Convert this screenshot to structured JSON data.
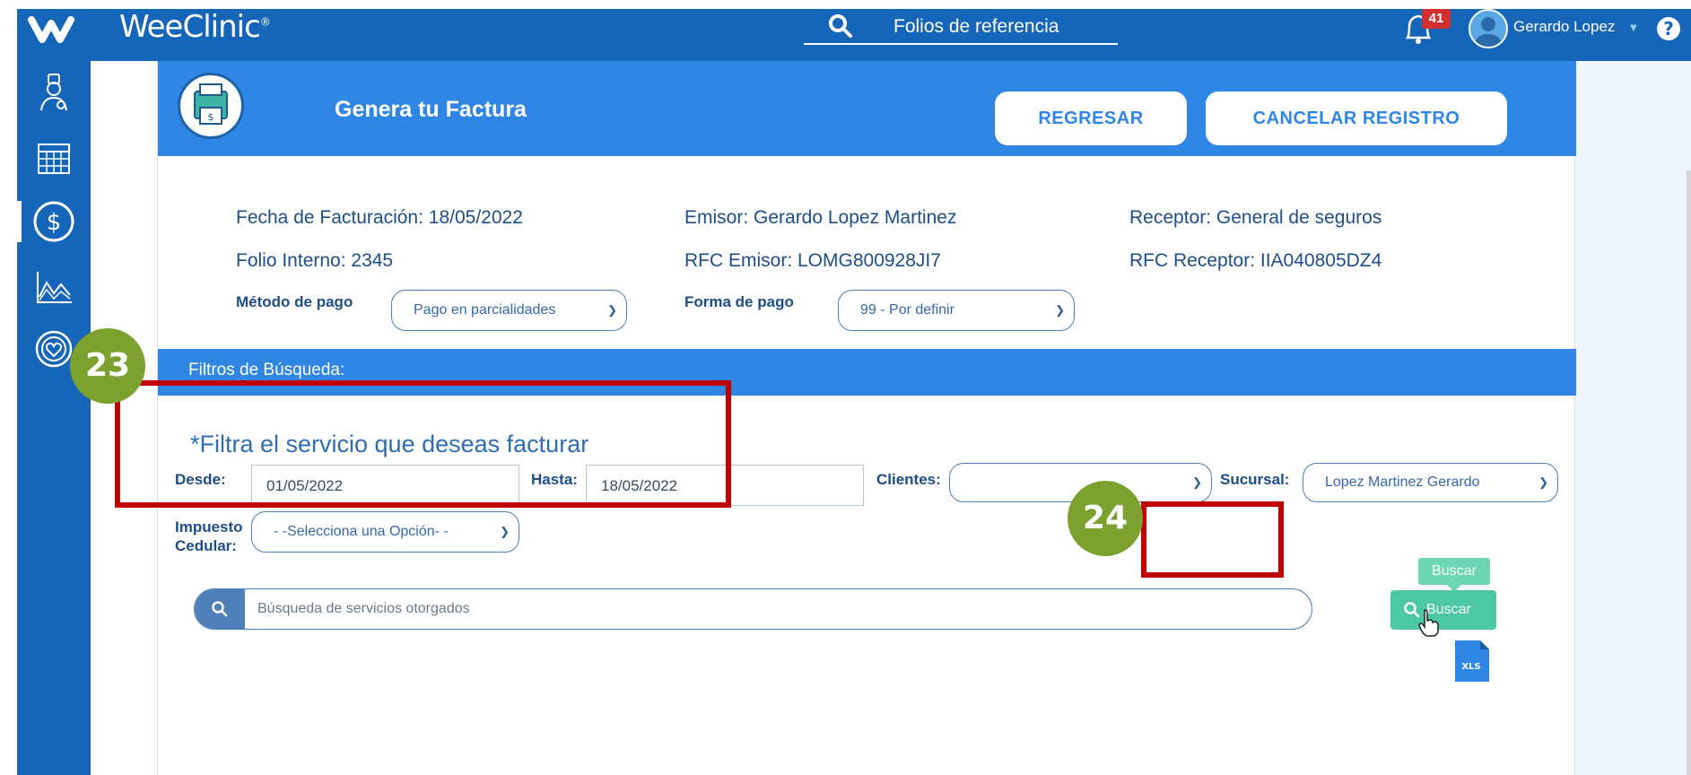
{
  "header": {
    "brand": "WeeClinic",
    "brand_mark": "®",
    "search_label": "Folios de referencia",
    "notification_count": "41",
    "user_name": "Gerardo Lopez"
  },
  "sidebar": {
    "items": [
      {
        "name": "doctor-icon"
      },
      {
        "name": "calendar-icon"
      },
      {
        "name": "billing-dollar-icon",
        "active": true
      },
      {
        "name": "chart-icon"
      },
      {
        "name": "heart-target-icon"
      }
    ]
  },
  "card": {
    "title": "Genera tu Factura",
    "back_button": "REGRESAR",
    "cancel_button": "CANCELAR REGISTRO"
  },
  "invoice": {
    "fecha": "Fecha de Facturación: 18/05/2022",
    "emisor": "Emisor: Gerardo Lopez Martinez",
    "receptor": "Receptor: General de seguros",
    "folio": "Folio Interno: 2345",
    "rfc_emisor": "RFC Emisor: LOMG800928JI7",
    "rfc_receptor": "RFC Receptor: IIA040805DZ4",
    "metodo_label": "Método de pago",
    "metodo_value": "Pago en parcialidades",
    "forma_label": "Forma de pago",
    "forma_value": "99 - Por definir"
  },
  "filters": {
    "bar_title": "Filtros de Búsqueda:",
    "subtitle": "*Filtra el servicio que deseas facturar",
    "desde_label": "Desde:",
    "desde_value": "01/05/2022",
    "hasta_label": "Hasta:",
    "hasta_value": "18/05/2022",
    "clientes_label": "Clientes:",
    "clientes_value": "",
    "sucursal_label": "Sucursal:",
    "sucursal_value": "Lopez Martinez Gerardo",
    "impuesto_label_1": "Impuesto",
    "impuesto_label_2": "Cedular:",
    "impuesto_value": "- -Selecciona una Opción- -",
    "search_placeholder": "Búsqueda de servicios otorgados",
    "buscar_button": "Buscar",
    "buscar_tooltip": "Buscar",
    "xls_label": "XLS"
  },
  "annotations": {
    "step_a": "23",
    "step_b": "24"
  },
  "colors": {
    "primary": "#1565b8",
    "header_blue": "#2f86e4",
    "accent_green": "#4cc8a2",
    "callout_red": "#c00000",
    "badge_green": "#7ca12e"
  }
}
